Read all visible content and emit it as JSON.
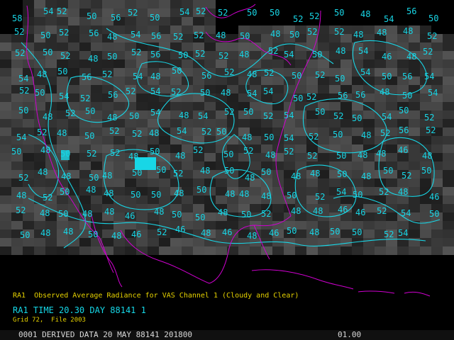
{
  "display": {
    "caption_desc": "RA1  Observed Average Radiance for VAS Channel 1 (Cloudy and Clear)",
    "caption_time": "RA1 TIME 20.30 DAY 88141 1",
    "caption_grid": "Grid 72,  File 2003",
    "status_text": "0001 DERIVED DATA 20 MAY 88141 201800",
    "frame_number": "01.00",
    "colors": {
      "contour": "#18d6e6",
      "map_outline": "#d000d0",
      "caption_yellow": "#e6d200",
      "caption_cyan": "#16d8e8",
      "status_text": "#d8d8d8"
    }
  },
  "contour_labels": [
    "58",
    "54",
    "52",
    "50",
    "56",
    "52",
    "50",
    "54",
    "52",
    "52",
    "50",
    "50",
    "52",
    "52",
    "50",
    "48",
    "54",
    "56",
    "50",
    "52",
    "50",
    "52",
    "56",
    "48",
    "54",
    "56",
    "52",
    "52",
    "48",
    "50",
    "48",
    "50",
    "52",
    "52",
    "48",
    "48",
    "48",
    "52",
    "52",
    "50",
    "52",
    "48",
    "50",
    "52",
    "56",
    "50",
    "52",
    "52",
    "48",
    "52",
    "54",
    "50",
    "48",
    "54",
    "46",
    "48",
    "52",
    "54",
    "48",
    "50",
    "56",
    "52",
    "54",
    "48",
    "50",
    "56",
    "52",
    "48",
    "52",
    "50",
    "52",
    "50",
    "54",
    "50",
    "56",
    "54",
    "52",
    "50",
    "54",
    "52",
    "56",
    "52",
    "54",
    "52",
    "50",
    "48",
    "54",
    "54",
    "50",
    "52",
    "56",
    "56",
    "48",
    "50",
    "54",
    "50",
    "48",
    "52",
    "50",
    "48",
    "50",
    "54",
    "48",
    "54",
    "52",
    "50",
    "52",
    "54",
    "50",
    "52",
    "50",
    "54",
    "50",
    "52",
    "54",
    "52",
    "48",
    "50",
    "52",
    "52",
    "48",
    "54",
    "52",
    "50",
    "48",
    "50",
    "54",
    "52",
    "50",
    "48",
    "52",
    "56",
    "52",
    "50",
    "48",
    "50",
    "52",
    "52",
    "48",
    "50",
    "48",
    "52",
    "50",
    "52",
    "48",
    "52",
    "52",
    "50",
    "48",
    "48",
    "46",
    "48",
    "52",
    "48",
    "48",
    "50",
    "48",
    "50",
    "50",
    "52",
    "48",
    "50",
    "48",
    "50",
    "48",
    "48",
    "50",
    "48",
    "50",
    "52",
    "50",
    "48",
    "52",
    "50",
    "48",
    "48",
    "50",
    "50",
    "48",
    "50",
    "48",
    "48",
    "48",
    "50",
    "52",
    "54",
    "50",
    "52",
    "48",
    "46",
    "52",
    "48",
    "50",
    "48",
    "48",
    "46",
    "48",
    "50",
    "50",
    "48",
    "50",
    "52",
    "48",
    "48",
    "46",
    "46",
    "52",
    "54",
    "50",
    "50",
    "48",
    "48",
    "50",
    "48",
    "46",
    "52",
    "46",
    "48",
    "46",
    "48",
    "46",
    "50",
    "48",
    "50",
    "50",
    "52",
    "54"
  ]
}
